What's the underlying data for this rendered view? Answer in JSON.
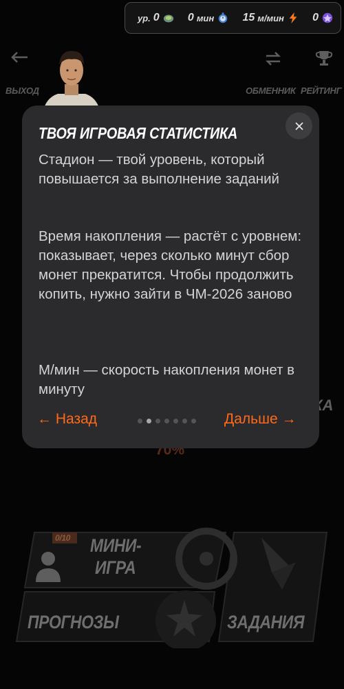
{
  "stats": {
    "level_label": "ур.",
    "level_value": "0",
    "minutes_value": "0",
    "minutes_unit": "мин",
    "rate_value": "15",
    "rate_unit": "м/мин",
    "gems_value": "0"
  },
  "header": {
    "exit_label": "ВЫХОД",
    "exchange_label": "ОБМЕННИК",
    "rating_label": "РЕЙТИНГ"
  },
  "background": {
    "percent": "70%",
    "side_text": "КА",
    "mini_game_line1": "МИНИ-",
    "mini_game_line2": "ИГРА",
    "counter": "0/10",
    "forecasts": "ПРОГНОЗЫ",
    "tasks": "ЗАДАНИЯ"
  },
  "modal": {
    "title": "ТВОЯ ИГРОВАЯ СТАТИСТИКА",
    "paragraph1": "Стадион — твой уровень, который повышается за выполнение заданий",
    "paragraph2": "Время накопления — растёт с уровнем: показывает, через сколько минут сбор монет прекратится. Чтобы продолжить копить, нужно зайти в ЧМ-2026 заново",
    "paragraph3": "М/мин — скорость накопления монет в минуту",
    "prev_label": "← Назад",
    "next_label": "Дальше →",
    "pages_total": 7,
    "current_page": 2
  },
  "colors": {
    "accent": "#ff6a1a",
    "modal_bg": "#2b2b2d",
    "page_bg": "#050505"
  }
}
